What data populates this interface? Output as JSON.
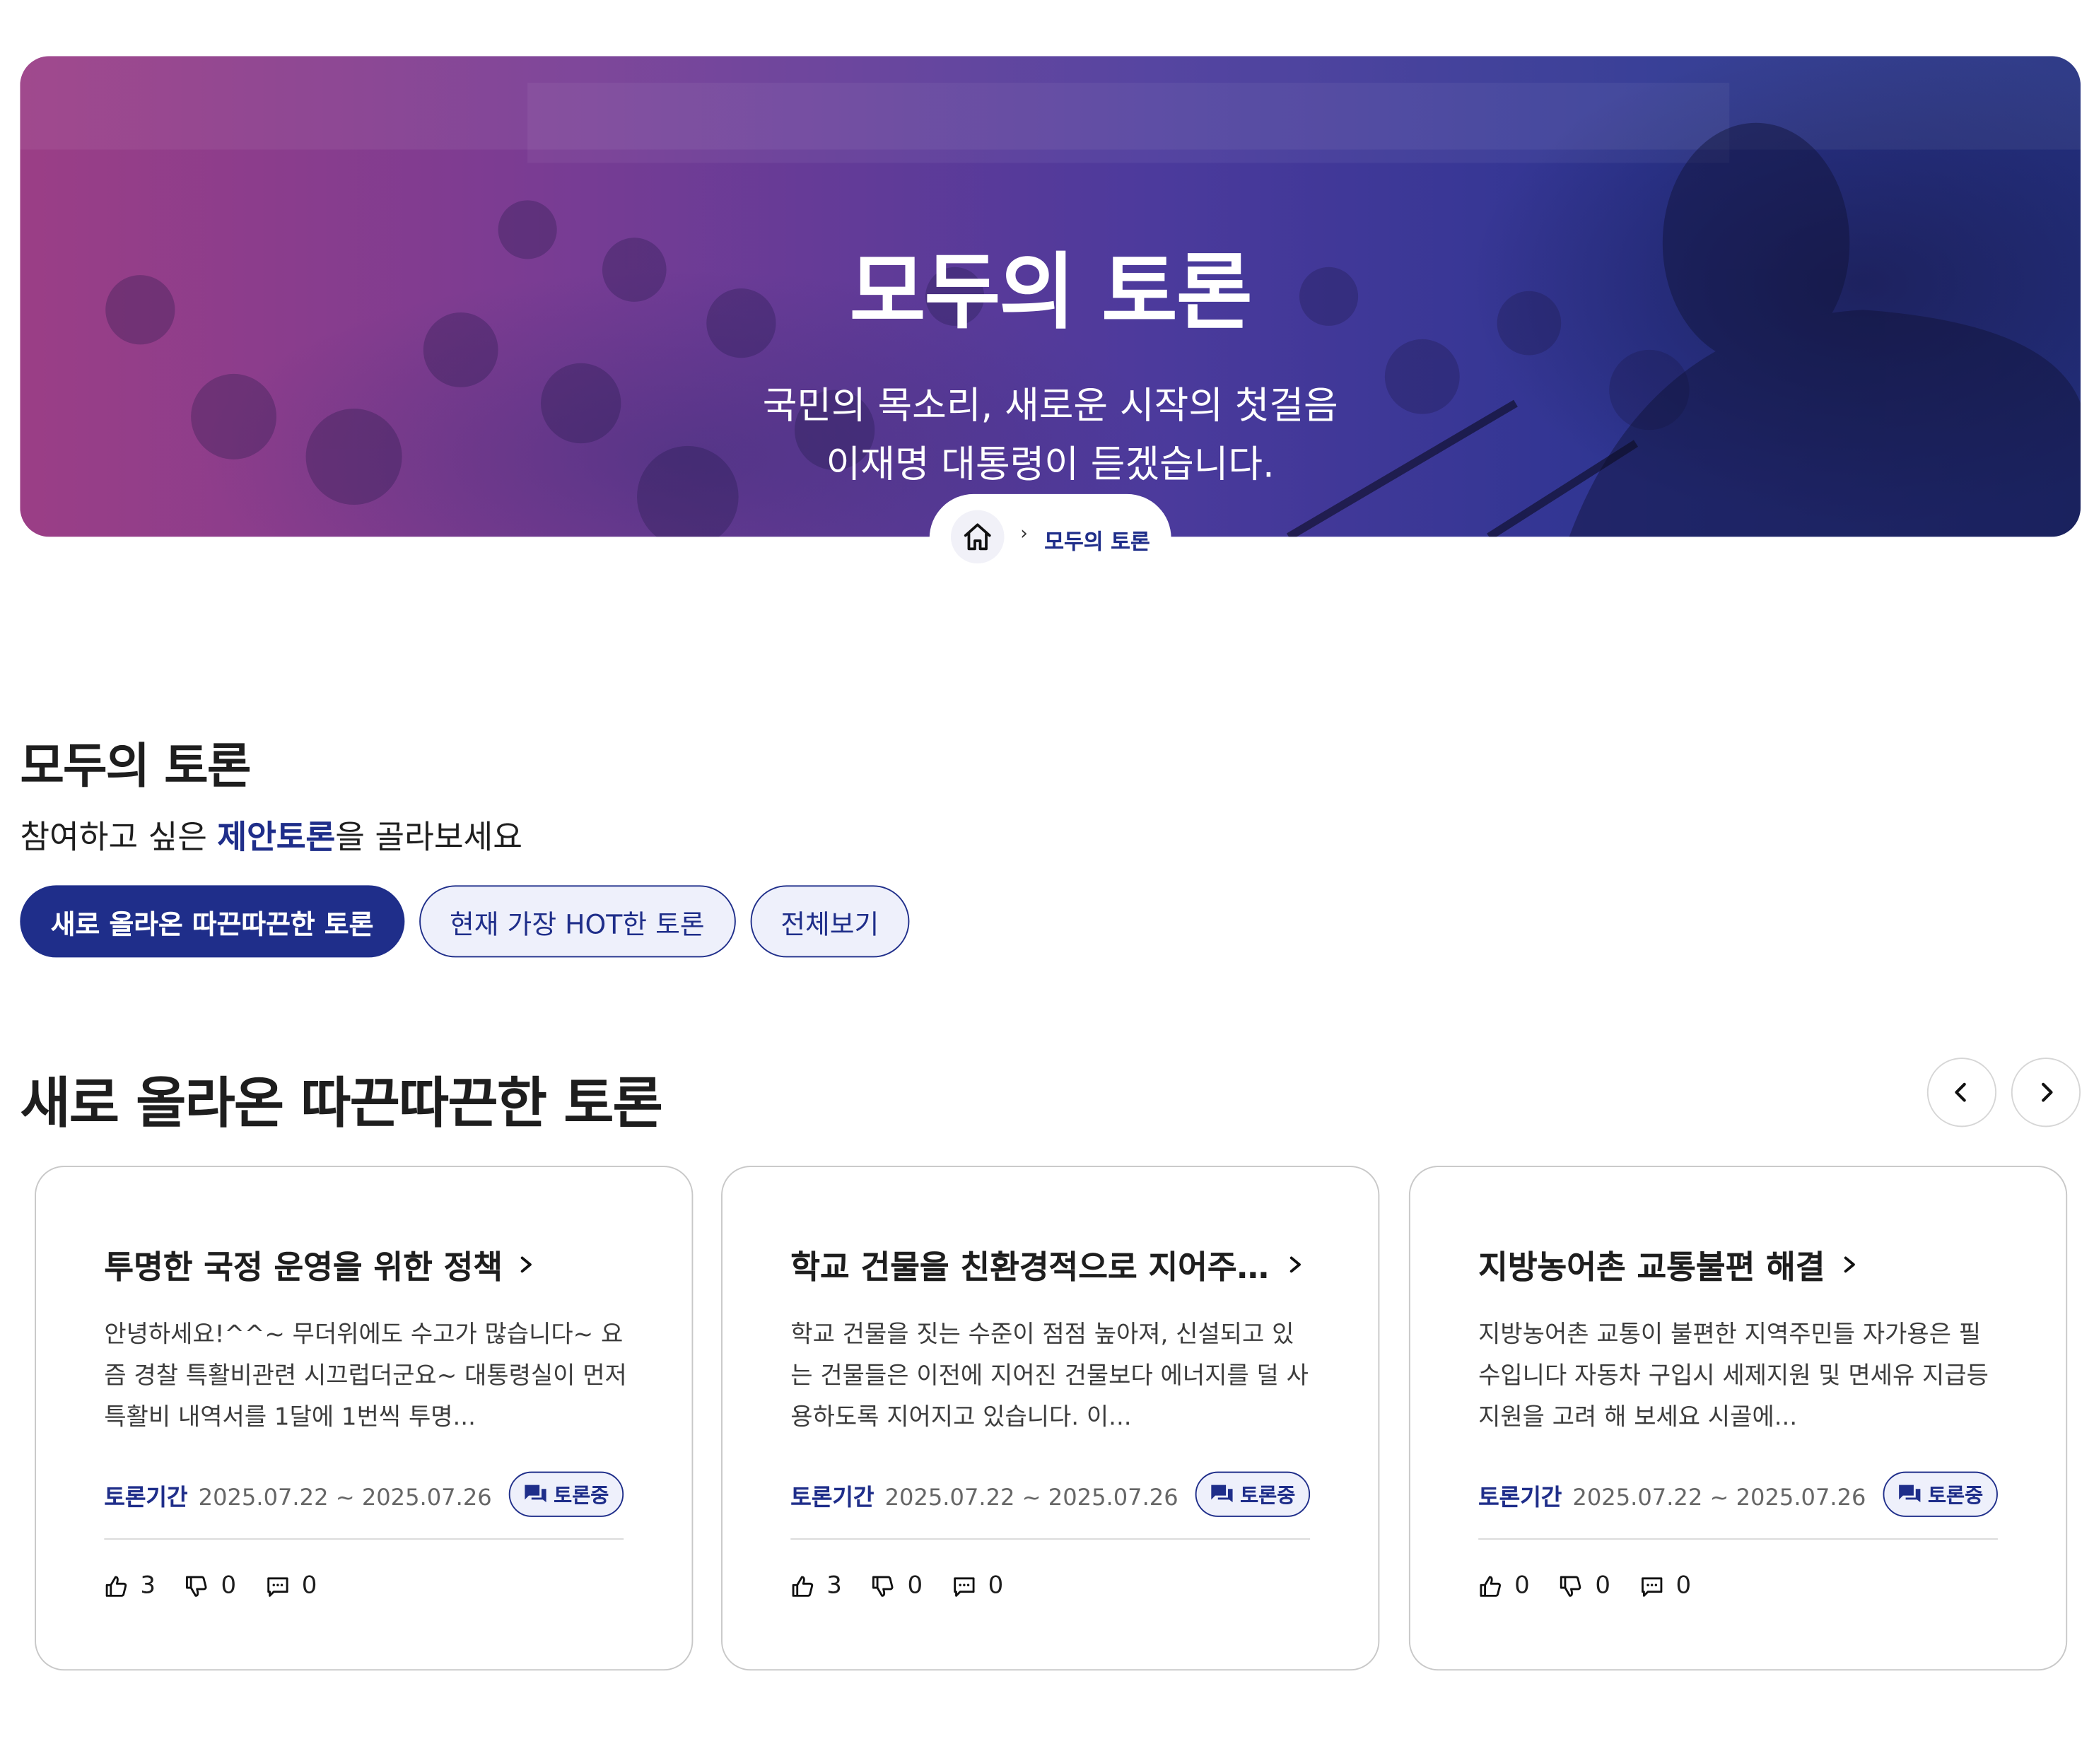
{
  "hero": {
    "title": "모두의 토론",
    "subtitle_line1": "국민의 목소리, 새로운 시작의 첫걸음",
    "subtitle_line2": "이재명 대통령이 듣겠습니다."
  },
  "breadcrumb": {
    "home_icon": "home-icon",
    "separator": "›",
    "current": "모두의 토론"
  },
  "section": {
    "title": "모두의 토론",
    "intro_prefix": "참여하고 싶은 ",
    "intro_highlight": "제안토론",
    "intro_suffix": "을 골라보세요"
  },
  "tabs": [
    {
      "label": "새로 올라온 따끈따끈한 토론",
      "active": true
    },
    {
      "label": "현재 가장 HOT한 토론",
      "active": false
    },
    {
      "label": "전체보기",
      "active": false
    }
  ],
  "subsection": {
    "title": "새로 올라온 따끈따끈한 토론"
  },
  "carousel": {
    "prev_icon": "chevron-left-icon",
    "next_icon": "chevron-right-icon"
  },
  "cards": [
    {
      "title": "투명한 국정 운영을 위한 정책",
      "body": "안녕하세요!^^~ 무더위에도 수고가 많습니다~ 요즘 경찰 특활비관련 시끄럽더군요~ 대통령실이 먼저 특활비 내역서를 1달에 1번씩 투명...",
      "period_label": "토론기간",
      "period": "2025.07.22 ~ 2025.07.26",
      "status": "토론중",
      "likes": "3",
      "dislikes": "0",
      "comments": "0"
    },
    {
      "title": "학교 건물을 친환경적으로 지어주...",
      "body": "학교 건물을 짓는 수준이 점점 높아져, 신설되고 있는 건물들은 이전에 지어진 건물보다 에너지를 덜 사용하도록 지어지고 있습니다. 이...",
      "period_label": "토론기간",
      "period": "2025.07.22 ~ 2025.07.26",
      "status": "토론중",
      "likes": "3",
      "dislikes": "0",
      "comments": "0"
    },
    {
      "title": "지방농어촌 교통불편 해결",
      "body": "지방농어촌 교통이 불편한 지역주민들 자가용은 필수입니다 자동차 구입시 세제지원 및 면세유 지급등 지원을 고려 해 보세요 시골에...",
      "period_label": "토론기간",
      "period": "2025.07.22 ~ 2025.07.26",
      "status": "토론중",
      "likes": "0",
      "dislikes": "0",
      "comments": "0"
    }
  ],
  "colors": {
    "primary": "#1f2e8a",
    "tab_bg": "#eef0fb",
    "hero_left": "#9b3e86",
    "hero_right": "#243080"
  }
}
